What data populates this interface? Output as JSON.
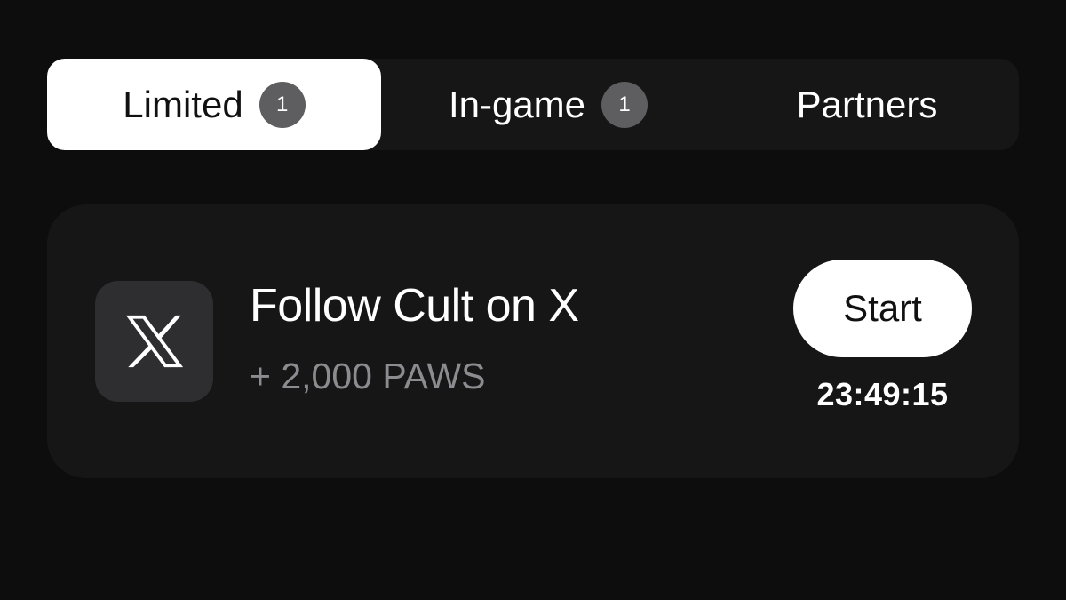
{
  "tabs": [
    {
      "label": "Limited",
      "badge": "1",
      "active": true
    },
    {
      "label": "In-game",
      "badge": "1",
      "active": false
    },
    {
      "label": "Partners",
      "badge": null,
      "active": false
    }
  ],
  "task": {
    "icon": "x-logo-icon",
    "title": "Follow Cult on X",
    "reward": "+ 2,000 PAWS",
    "button_label": "Start",
    "timer": "23:49:15"
  },
  "colors": {
    "background": "#0d0d0e",
    "surface": "#161617",
    "active_tab": "#ffffff",
    "badge": "#5e5e60",
    "icon_tile": "#2e2e30",
    "muted_text": "#8c8c90"
  }
}
